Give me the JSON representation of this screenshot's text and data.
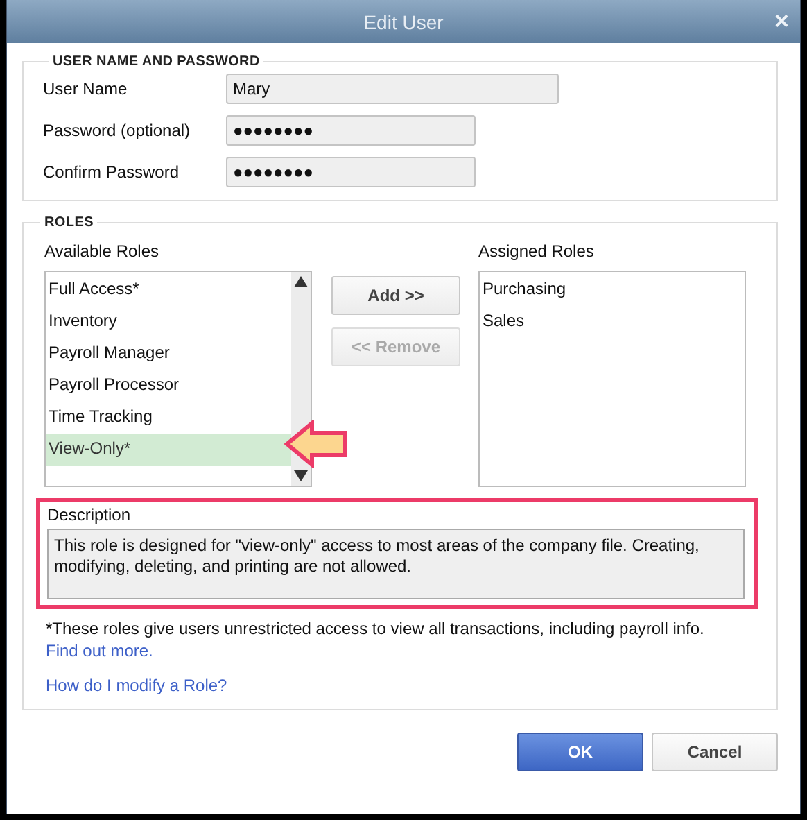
{
  "window": {
    "title": "Edit User",
    "close": "×"
  },
  "credentials": {
    "legend": "USER NAME AND PASSWORD",
    "fields": [
      {
        "label": "User Name",
        "value": "Mary",
        "wide": true
      },
      {
        "label": "Password (optional)",
        "value": "●●●●●●●●",
        "wide": false
      },
      {
        "label": "Confirm Password",
        "value": "●●●●●●●●",
        "wide": false
      }
    ]
  },
  "roles": {
    "legend": "ROLES",
    "available_label": "Available Roles",
    "available": [
      {
        "label": "Full Access*",
        "selected": false
      },
      {
        "label": "Inventory",
        "selected": false
      },
      {
        "label": "Payroll Manager",
        "selected": false
      },
      {
        "label": "Payroll Processor",
        "selected": false
      },
      {
        "label": "Time Tracking",
        "selected": false
      },
      {
        "label": "View-Only*",
        "selected": true
      }
    ],
    "buttons": [
      {
        "label": "Add >>",
        "disabled": false
      },
      {
        "label": "<< Remove",
        "disabled": true
      }
    ],
    "assigned_label": "Assigned Roles",
    "assigned": [
      {
        "label": "Purchasing",
        "selected": false
      },
      {
        "label": "Sales",
        "selected": false
      }
    ],
    "description_label": "Description",
    "description": "This role is designed for \"view-only\" access to most areas of the company file. Creating, modifying, deleting, and printing are not allowed.",
    "footnote": "*These roles give users unrestricted access to view all transactions, including payroll info.",
    "links": [
      "Find out more.",
      "How do I modify a Role?"
    ]
  },
  "callouts": {
    "arrow": true,
    "frame": true
  },
  "buttons": [
    {
      "label": "OK",
      "primary": true
    },
    {
      "label": "Cancel",
      "primary": false
    }
  ]
}
